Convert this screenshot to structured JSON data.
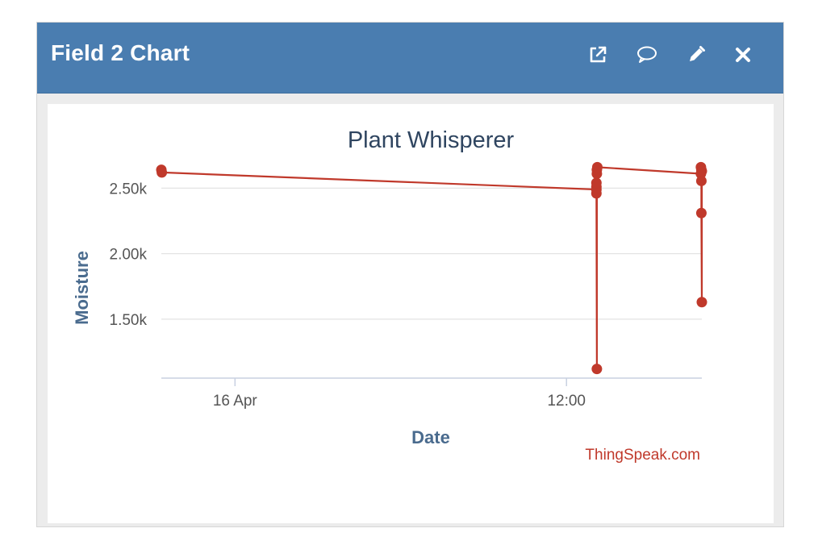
{
  "window": {
    "title": "Field 2 Chart",
    "actions": [
      {
        "name": "open-external-icon",
        "label": "Open in new window"
      },
      {
        "name": "comment-icon",
        "label": "Comment"
      },
      {
        "name": "edit-icon",
        "label": "Edit"
      },
      {
        "name": "close-icon",
        "label": "Close"
      }
    ]
  },
  "chart_data": {
    "type": "line",
    "title": "Plant Whisperer",
    "xlabel": "Date",
    "ylabel": "Moisture",
    "credit": "ThingSpeak.com",
    "color": "#c0392b",
    "grid": true,
    "legend": "none",
    "xlim": [
      "2024-04-15 21:20",
      "2024-04-16 16:54"
    ],
    "ylim": [
      1050,
      2650
    ],
    "x_ticks": [
      {
        "value": "2024-04-16 00:00",
        "label": "16 Apr"
      },
      {
        "value": "2024-04-16 12:00",
        "label": "12:00"
      }
    ],
    "y_ticks": [
      {
        "value": 1500,
        "label": "1.50k"
      },
      {
        "value": 2000,
        "label": "2.00k"
      },
      {
        "value": 2500,
        "label": "2.50k"
      }
    ],
    "series": [
      {
        "points": [
          [
            "2024-04-15 21:20",
            2640
          ],
          [
            "2024-04-15 21:21",
            2620
          ],
          [
            "2024-04-16 13:05",
            2490
          ],
          [
            "2024-04-16 13:05",
            2460
          ],
          [
            "2024-04-16 13:05",
            2510
          ],
          [
            "2024-04-16 13:05",
            2540
          ],
          [
            "2024-04-16 13:06",
            1120
          ],
          [
            "2024-04-16 13:06",
            2610
          ],
          [
            "2024-04-16 13:06",
            2640
          ],
          [
            "2024-04-16 13:07",
            2660
          ],
          [
            "2024-04-16 16:52",
            2610
          ],
          [
            "2024-04-16 16:52",
            2660
          ],
          [
            "2024-04-16 16:53",
            2640
          ],
          [
            "2024-04-16 16:53",
            2555
          ],
          [
            "2024-04-16 16:53",
            2310
          ],
          [
            "2024-04-16 16:54",
            1630
          ],
          [
            "2024-04-16 16:54",
            2630
          ]
        ]
      }
    ]
  }
}
